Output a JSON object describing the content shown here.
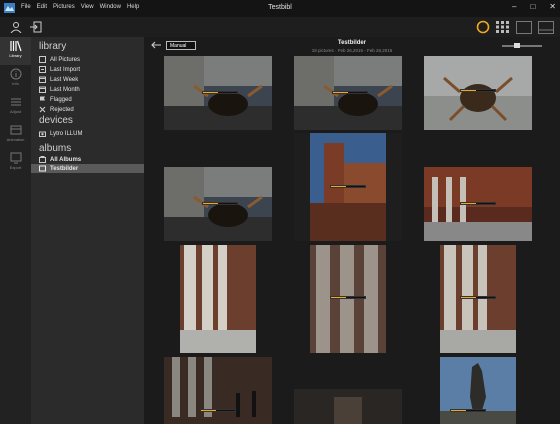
{
  "window": {
    "title": "Testbibl",
    "menu": [
      "File",
      "Edit",
      "Pictures",
      "View",
      "Window",
      "Help"
    ],
    "controls": [
      "–",
      "□",
      "✕"
    ]
  },
  "toolbar": {
    "views": [
      "living-picture-view",
      "grid-view",
      "single-view",
      "compare-view"
    ]
  },
  "rail": [
    {
      "label": "Library",
      "icon": "library-icon",
      "active": true
    },
    {
      "label": "Info",
      "icon": "info-icon",
      "active": false
    },
    {
      "label": "Adjust",
      "icon": "adjust-icon",
      "active": false
    },
    {
      "label": "Animation",
      "icon": "animation-icon",
      "active": false
    },
    {
      "label": "Export",
      "icon": "export-icon",
      "active": false
    }
  ],
  "sidebar": {
    "library_heading": "library",
    "library": [
      {
        "label": "All Pictures",
        "icon": "pictures-icon"
      },
      {
        "label": "Last Import",
        "icon": "import-icon"
      },
      {
        "label": "Last Week",
        "icon": "calendar-icon"
      },
      {
        "label": "Last Month",
        "icon": "calendar-icon"
      },
      {
        "label": "Flagged",
        "icon": "flag-icon"
      },
      {
        "label": "Rejected",
        "icon": "x-icon"
      }
    ],
    "devices_heading": "devices",
    "devices": [
      {
        "label": "Lytro ILLUM",
        "icon": "camera-icon"
      }
    ],
    "albums_heading": "albums",
    "albums": [
      {
        "label": "All Albums",
        "icon": "albums-icon",
        "bold": true
      },
      {
        "label": "Testbilder",
        "icon": "album-icon",
        "selected": true
      }
    ]
  },
  "album": {
    "sort": "Manual",
    "title": "Testbilder",
    "subtitle": "19 pictures  ·  Feb 26,2015 - Feb 26,2015"
  },
  "accent": "#f0a820",
  "thumbnails": [
    {
      "subject": "crab-plaza",
      "progress": 0.45
    },
    {
      "subject": "crab-plaza",
      "progress": 0.45
    },
    {
      "subject": "crab-sky",
      "progress": 0.45
    },
    {
      "subject": "tower",
      "progress": 0.45
    },
    {
      "subject": "crab-plaza",
      "progress": 0.45
    },
    {
      "subject": "arcade",
      "progress": 0.45
    },
    {
      "subject": "columns",
      "progress": 0.45
    },
    {
      "subject": "columns-blur",
      "progress": 0.45
    },
    {
      "subject": "columns",
      "progress": 0.45
    },
    {
      "subject": "columns-people",
      "progress": 0.45
    },
    {
      "subject": "dark",
      "progress": 0.45
    },
    {
      "subject": "statue",
      "progress": 0.45
    }
  ]
}
